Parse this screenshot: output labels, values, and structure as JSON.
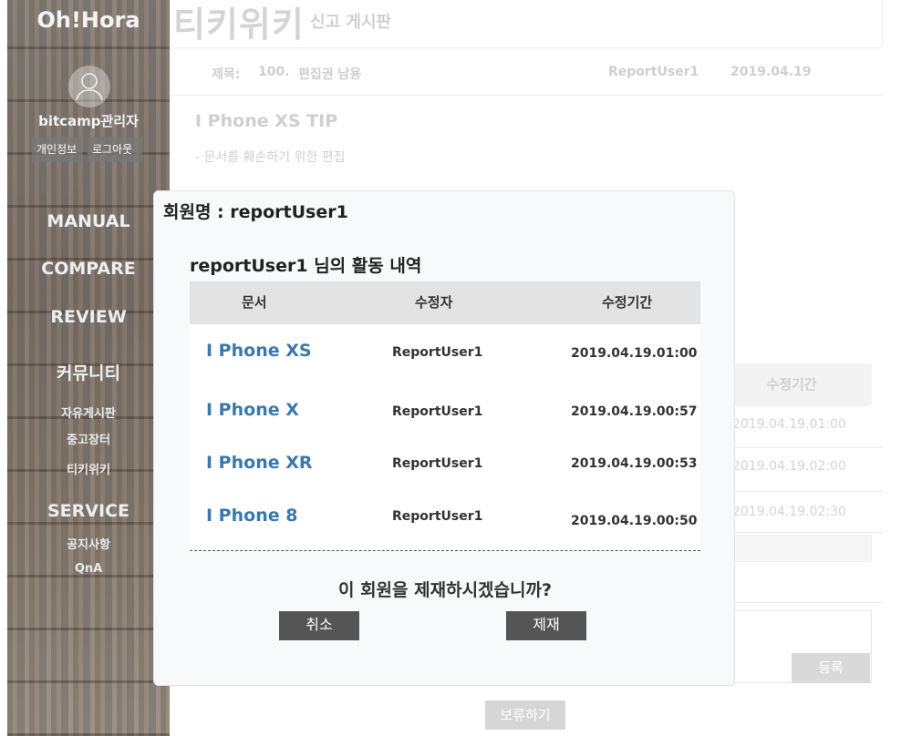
{
  "sidebar": {
    "logo": "Oh!Hora",
    "username": "bitcamp관리자",
    "profile_button": "개인정보",
    "logout_button": "로그아웃",
    "menu": {
      "manual": "MANUAL",
      "compare": "COMPARE",
      "review": "REVIEW",
      "community": "커뮤니티",
      "free_board": "자유게시판",
      "used_market": "중고장터",
      "tikiwiki": "티키위키",
      "service": "SERVICE",
      "notice": "공지사항",
      "qna": "QnA"
    }
  },
  "page": {
    "title": "티키위키",
    "subtitle": "신고 게시판",
    "meta": {
      "subject_label": "제목:",
      "number": "100.",
      "subject": "편집권 남용",
      "author": "ReportUser1",
      "date": "2019.04.19"
    },
    "post_title": "I Phone XS TIP",
    "post_desc": "- 문서를 훼손하기 위한 편집",
    "history_header": "수정기간",
    "history_dates": [
      "2019.04.19.01:00",
      "2019.04.19.02:00",
      "2019.04.19.02:30"
    ],
    "register_button": "등록",
    "hold_button": "보류하기"
  },
  "modal": {
    "member_label": "회원명 : reportUser1",
    "activity_title": "reportUser1 님의 활동 내역",
    "columns": [
      "문서",
      "수정자",
      "수정기간"
    ],
    "rows": [
      {
        "doc": "I Phone XS",
        "editor": "ReportUser1",
        "date": "2019.04.19.01:00"
      },
      {
        "doc": "I Phone X",
        "editor": "ReportUser1",
        "date": "2019.04.19.00:57"
      },
      {
        "doc": "I Phone XR",
        "editor": "ReportUser1",
        "date": "2019.04.19.00:53"
      },
      {
        "doc": "I Phone 8",
        "editor": "ReportUser1",
        "date": "2019.04.19.00:50"
      }
    ],
    "question": "이 회원을 제재하시겠습니까?",
    "cancel_button": "취소",
    "ban_button": "제재"
  },
  "colors": {
    "link": "#3a78ad",
    "button_dark": "#555555",
    "table_header": "#e3e3e3"
  }
}
